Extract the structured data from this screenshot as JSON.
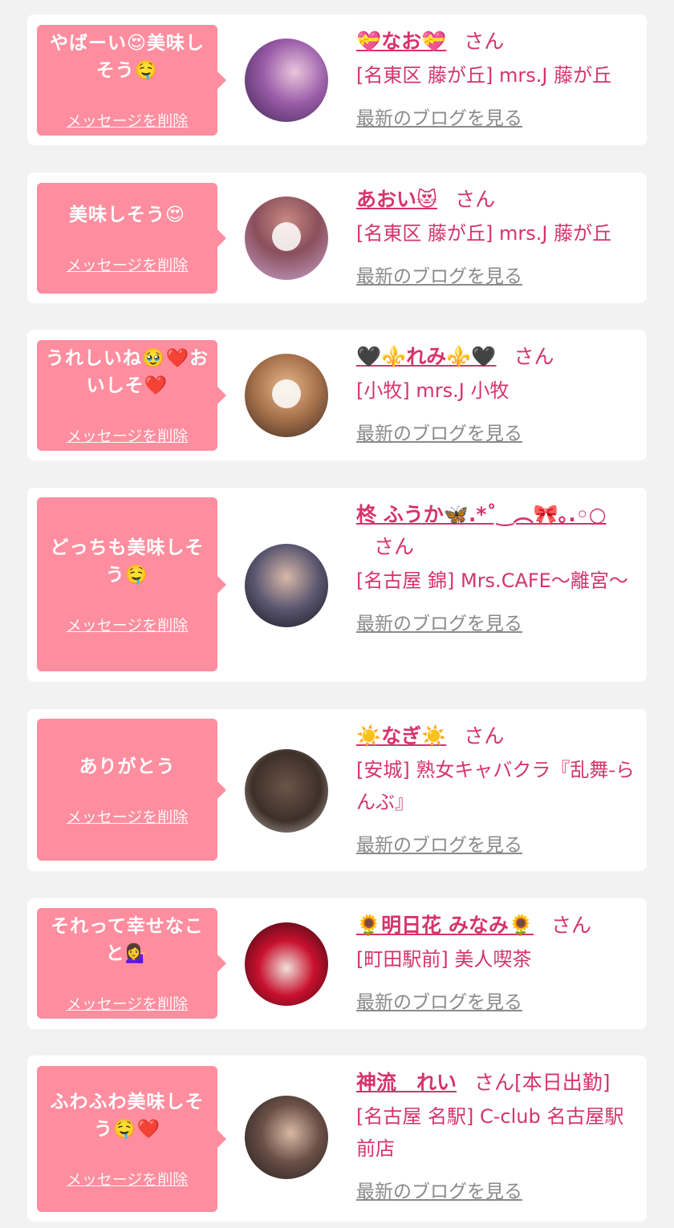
{
  "delete_label": "メッセージを削除",
  "blog_label": "最新のブログを見る",
  "san_label": "さん",
  "colors": {
    "background": "#f2f2f2",
    "card": "#ffffff",
    "bubble": "#fe8e9f",
    "accent_text": "#d6336c",
    "link_gray": "#8a8a8a"
  },
  "messages": [
    {
      "message": "やばーい😍美味しそう🤤",
      "name": "💝なお💝",
      "san_suffix": "",
      "shop": "[名東区 藤が丘] mrs.J 藤が丘",
      "avatar": "avatar-purple-photo"
    },
    {
      "message": "美味しそう😍",
      "name": "あおい😻",
      "san_suffix": "",
      "shop": "[名東区 藤が丘] mrs.J 藤が丘",
      "avatar": "avatar-heart-cover-photo"
    },
    {
      "message": "うれしいね🥹❤️おいしそ❤️",
      "name": "🖤⚜️れみ⚜️🖤",
      "san_suffix": "",
      "shop": "[小牧] mrs.J 小牧",
      "avatar": "avatar-heart-cover-photo"
    },
    {
      "message": "どっちも美味しそう🤤",
      "name": "柊 ふうか🦋.*˚‿︵🎀｡.◦○",
      "san_suffix": "",
      "shop": "[名古屋 錦] Mrs.CAFE～離宮～",
      "avatar": "avatar-peace-sign-photo"
    },
    {
      "message": "ありがとう",
      "name": "☀️なぎ☀️",
      "san_suffix": "",
      "shop": "[安城] 熟女キャバクラ『乱舞-らんぶ』",
      "avatar": "avatar-hair-back-photo"
    },
    {
      "message": "それって幸せなこと💁‍♀️",
      "name": "🌻明日花 みなみ🌻",
      "san_suffix": "",
      "shop": "[町田駅前] 美人喫茶",
      "avatar": "avatar-red-carpet-photo"
    },
    {
      "message": "ふわふわ美味しそう🤤❤️",
      "name": "神流　れい",
      "san_suffix": "[本日出勤]",
      "shop": "[名古屋 名駅] C-club 名古屋駅前店",
      "avatar": "avatar-dark-portrait-photo"
    }
  ]
}
